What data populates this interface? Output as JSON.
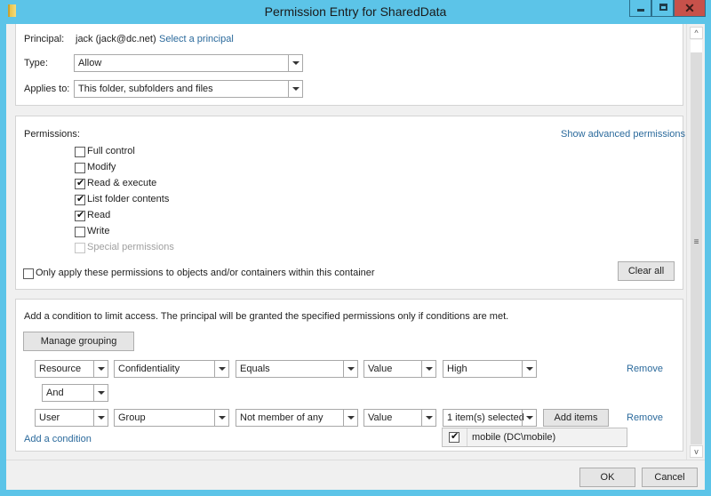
{
  "window": {
    "title": "Permission Entry for SharedData",
    "controls": {
      "minimize": "minimize",
      "maximize": "maximize",
      "close": "✕"
    }
  },
  "principal": {
    "label": "Principal:",
    "value": "jack (jack@dc.net)",
    "select_link": "Select a principal"
  },
  "type": {
    "label": "Type:",
    "value": "Allow"
  },
  "applies_to": {
    "label": "Applies to:",
    "value": "This folder, subfolders and files"
  },
  "permissions": {
    "label": "Permissions:",
    "advanced_link": "Show advanced permissions",
    "items": [
      {
        "label": "Full control",
        "checked": false,
        "disabled": false
      },
      {
        "label": "Modify",
        "checked": false,
        "disabled": false
      },
      {
        "label": "Read & execute",
        "checked": true,
        "disabled": false
      },
      {
        "label": "List folder contents",
        "checked": true,
        "disabled": false
      },
      {
        "label": "Read",
        "checked": true,
        "disabled": false
      },
      {
        "label": "Write",
        "checked": false,
        "disabled": false
      },
      {
        "label": "Special permissions",
        "checked": false,
        "disabled": true
      }
    ],
    "only_apply_label": "Only apply these permissions to objects and/or containers within this container",
    "only_apply_checked": false,
    "clear_all": "Clear all"
  },
  "conditions": {
    "description": "Add a condition to limit access. The principal will be granted the specified permissions only if conditions are met.",
    "manage_grouping": "Manage grouping",
    "rows": [
      {
        "scope": "Resource",
        "attribute": "Confidentiality",
        "operator": "Equals",
        "value_type": "Value",
        "value": "High",
        "remove": "Remove"
      },
      {
        "scope": "User",
        "attribute": "Group",
        "operator": "Not member of any",
        "value_type": "Value",
        "value": "1 item(s) selected",
        "add_items": "Add items",
        "remove": "Remove"
      }
    ],
    "connector": "And",
    "add_condition": "Add a condition",
    "dropdown_items": [
      {
        "label": "mobile (DC\\mobile)",
        "checked": true
      }
    ]
  },
  "footer": {
    "ok": "OK",
    "cancel": "Cancel"
  }
}
